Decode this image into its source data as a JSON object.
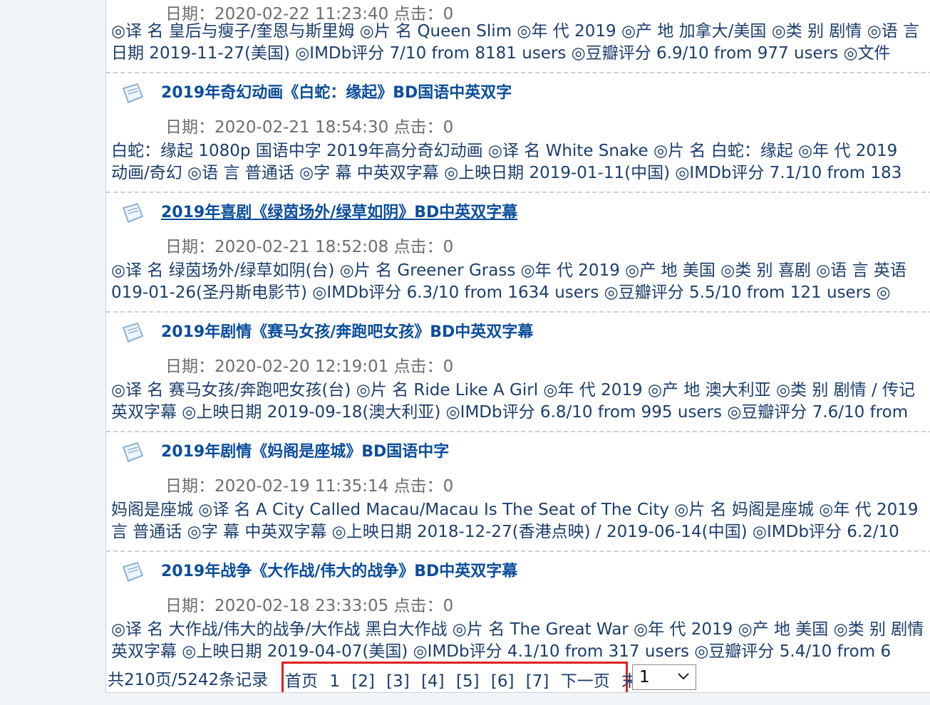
{
  "posts": [
    {
      "title": "",
      "date": "日期：2020-02-22 11:23:40 点击：0",
      "desc1": "◎译 名 皇后与瘦子/奎恩与斯里姆 ◎片 名 Queen Slim ◎年 代 2019 ◎产 地 加拿大/美国 ◎类 别 剧情 ◎语 言",
      "desc2": "日期 2019-11-27(美国) ◎IMDb评分 7/10 from 8181 users ◎豆瓣评分 6.9/10 from 977 users ◎文件"
    },
    {
      "title": "2019年奇幻动画《白蛇：缘起》BD国语中英双字",
      "date": "日期：2020-02-21 18:54:30 点击：0",
      "desc1": "白蛇：缘起 1080p 国语中字 2019年高分奇幻动画 ◎译 名 White Snake ◎片 名 白蛇：缘起 ◎年 代 2019",
      "desc2": "动画/奇幻 ◎语 言 普通话 ◎字 幕 中英双字幕 ◎上映日期 2019-01-11(中国) ◎IMDb评分 7.1/10 from 183"
    },
    {
      "title": "2019年喜剧《绿茵场外/绿草如阴》BD中英双字幕",
      "date": "日期：2020-02-21 18:52:08 点击：0",
      "desc1": "◎译 名 绿茵场外/绿草如阴(台) ◎片 名 Greener Grass ◎年 代 2019 ◎产 地 美国 ◎类 别 喜剧 ◎语 言 英语",
      "desc2": "019-01-26(圣丹斯电影节) ◎IMDb评分 6.3/10 from 1634 users ◎豆瓣评分 5.5/10 from 121 users ◎"
    },
    {
      "title": "2019年剧情《赛马女孩/奔跑吧女孩》BD中英双字幕",
      "date": "日期：2020-02-20 12:19:01 点击：0",
      "desc1": "◎译 名 赛马女孩/奔跑吧女孩(台) ◎片 名 Ride Like A Girl ◎年 代 2019 ◎产 地 澳大利亚 ◎类 别 剧情 / 传记",
      "desc2": "英双字幕 ◎上映日期 2019-09-18(澳大利亚) ◎IMDb评分 6.8/10 from 995 users ◎豆瓣评分 7.6/10 from"
    },
    {
      "title": "2019年剧情《妈阁是座城》BD国语中字",
      "date": "日期：2020-02-19 11:35:14 点击：0",
      "desc1": "妈阁是座城 ◎译 名 A City Called Macau/Macau Is The Seat of The City ◎片 名 妈阁是座城 ◎年 代 2019",
      "desc2": "言 普通话 ◎字 幕 中英双字幕 ◎上映日期 2018-12-27(香港点映) / 2019-06-14(中国) ◎IMDb评分 6.2/10"
    },
    {
      "title": "2019年战争《大作战/伟大的战争》BD中英双字幕",
      "date": "日期：2020-02-18 23:33:05 点击：0",
      "desc1": "◎译 名 大作战/伟大的战争/大作战 黑白大作战 ◎片 名 The Great War ◎年 代 2019 ◎产 地 美国 ◎类 别 剧情",
      "desc2": "英双字幕 ◎上映日期 2019-04-07(美国) ◎IMDb评分 4.1/10 from 317 users ◎豆瓣评分 5.4/10 from 6"
    }
  ],
  "pager": {
    "total": "共210页/5242条记录",
    "first": "首页",
    "current": "1",
    "pages": [
      "[2]",
      "[3]",
      "[4]",
      "[5]",
      "[6]",
      "[7]"
    ],
    "next": "下一页",
    "last": "末页",
    "selected": "1",
    "chevron": "⌵"
  },
  "colors": {
    "title": "#0a4d9c",
    "text": "#1b3e6e",
    "meta": "#6e6e6e",
    "highlight_box": "#e02020"
  },
  "icon_name": "document-icon"
}
